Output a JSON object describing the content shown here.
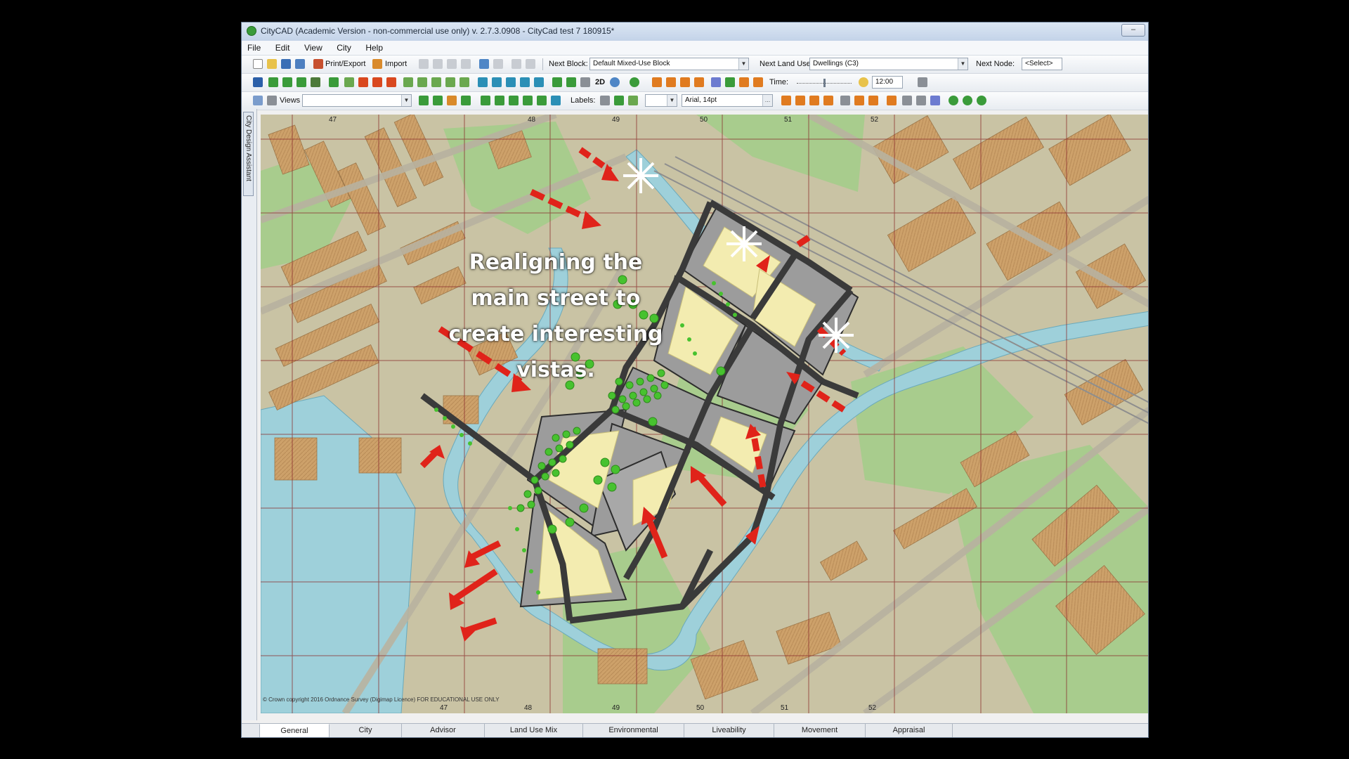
{
  "window": {
    "title": "CityCAD (Academic Version - non-commercial use only)  v. 2.7.3.0908 - CityCad test 7 180915*",
    "minimize_label": "–"
  },
  "menu": [
    "File",
    "Edit",
    "View",
    "City",
    "Help"
  ],
  "toolbar1": {
    "print_export": "Print/Export",
    "import": "Import",
    "next_block_label": "Next Block:",
    "next_block_value": "Default Mixed-Use Block",
    "next_land_use_label": "Next Land Use:",
    "next_land_use_value": "Dwellings (C3)",
    "next_node_label": "Next Node:",
    "next_node_value": "<Select>"
  },
  "toolbar2": {
    "mode_2d": "2D",
    "time_label": "Time:",
    "time_value": "12:00"
  },
  "toolbar3": {
    "views_label": "Views",
    "views_value": "",
    "labels_label": "Labels:",
    "font_value": "Arial, 14pt"
  },
  "left_panel": {
    "tab_label": "City Design Assistant"
  },
  "map": {
    "grid_top_labels": [
      "47",
      "48",
      "49",
      "50",
      "51",
      "52"
    ],
    "grid_bottom_labels": [
      "47",
      "48",
      "49",
      "50",
      "51",
      "52"
    ],
    "overlay_text": [
      "Realigning the",
      "main street to",
      "create interesting",
      "vistas."
    ],
    "copyright": "© Crown copyright 2016 Ordnance Survey (Digimap Licence)  FOR EDUCATIONAL USE ONLY"
  },
  "bottom_tabs": [
    "General",
    "City",
    "Advisor",
    "Land Use Mix",
    "Environmental",
    "Liveability",
    "Movement",
    "Appraisal"
  ],
  "colors": {
    "water": "#9fd0dc",
    "green_space": "#a9cc8e",
    "buildings": "#cfa56e",
    "roads": "#3a3a3a",
    "arrows": "#e0241b",
    "trees": "#46c22e"
  }
}
